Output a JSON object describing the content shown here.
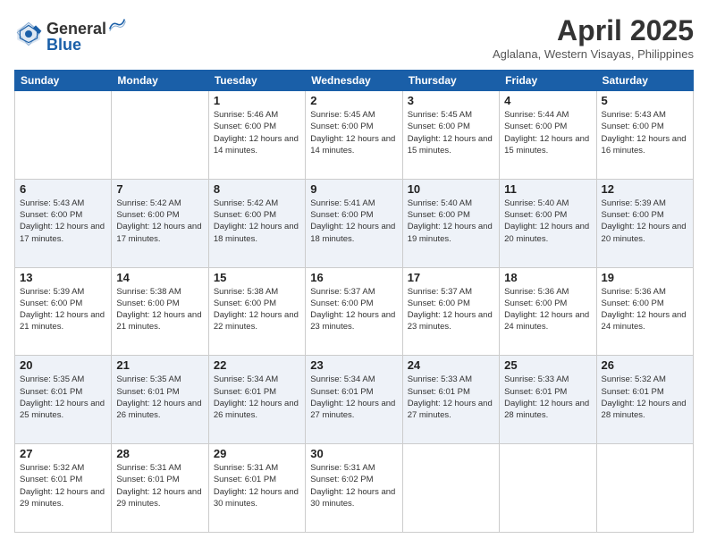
{
  "header": {
    "logo_general": "General",
    "logo_blue": "Blue",
    "month_year": "April 2025",
    "location": "Aglalana, Western Visayas, Philippines"
  },
  "columns": [
    "Sunday",
    "Monday",
    "Tuesday",
    "Wednesday",
    "Thursday",
    "Friday",
    "Saturday"
  ],
  "weeks": [
    [
      {
        "day": "",
        "info": ""
      },
      {
        "day": "",
        "info": ""
      },
      {
        "day": "1",
        "info": "Sunrise: 5:46 AM\nSunset: 6:00 PM\nDaylight: 12 hours\nand 14 minutes."
      },
      {
        "day": "2",
        "info": "Sunrise: 5:45 AM\nSunset: 6:00 PM\nDaylight: 12 hours\nand 14 minutes."
      },
      {
        "day": "3",
        "info": "Sunrise: 5:45 AM\nSunset: 6:00 PM\nDaylight: 12 hours\nand 15 minutes."
      },
      {
        "day": "4",
        "info": "Sunrise: 5:44 AM\nSunset: 6:00 PM\nDaylight: 12 hours\nand 15 minutes."
      },
      {
        "day": "5",
        "info": "Sunrise: 5:43 AM\nSunset: 6:00 PM\nDaylight: 12 hours\nand 16 minutes."
      }
    ],
    [
      {
        "day": "6",
        "info": "Sunrise: 5:43 AM\nSunset: 6:00 PM\nDaylight: 12 hours\nand 17 minutes."
      },
      {
        "day": "7",
        "info": "Sunrise: 5:42 AM\nSunset: 6:00 PM\nDaylight: 12 hours\nand 17 minutes."
      },
      {
        "day": "8",
        "info": "Sunrise: 5:42 AM\nSunset: 6:00 PM\nDaylight: 12 hours\nand 18 minutes."
      },
      {
        "day": "9",
        "info": "Sunrise: 5:41 AM\nSunset: 6:00 PM\nDaylight: 12 hours\nand 18 minutes."
      },
      {
        "day": "10",
        "info": "Sunrise: 5:40 AM\nSunset: 6:00 PM\nDaylight: 12 hours\nand 19 minutes."
      },
      {
        "day": "11",
        "info": "Sunrise: 5:40 AM\nSunset: 6:00 PM\nDaylight: 12 hours\nand 20 minutes."
      },
      {
        "day": "12",
        "info": "Sunrise: 5:39 AM\nSunset: 6:00 PM\nDaylight: 12 hours\nand 20 minutes."
      }
    ],
    [
      {
        "day": "13",
        "info": "Sunrise: 5:39 AM\nSunset: 6:00 PM\nDaylight: 12 hours\nand 21 minutes."
      },
      {
        "day": "14",
        "info": "Sunrise: 5:38 AM\nSunset: 6:00 PM\nDaylight: 12 hours\nand 21 minutes."
      },
      {
        "day": "15",
        "info": "Sunrise: 5:38 AM\nSunset: 6:00 PM\nDaylight: 12 hours\nand 22 minutes."
      },
      {
        "day": "16",
        "info": "Sunrise: 5:37 AM\nSunset: 6:00 PM\nDaylight: 12 hours\nand 23 minutes."
      },
      {
        "day": "17",
        "info": "Sunrise: 5:37 AM\nSunset: 6:00 PM\nDaylight: 12 hours\nand 23 minutes."
      },
      {
        "day": "18",
        "info": "Sunrise: 5:36 AM\nSunset: 6:00 PM\nDaylight: 12 hours\nand 24 minutes."
      },
      {
        "day": "19",
        "info": "Sunrise: 5:36 AM\nSunset: 6:00 PM\nDaylight: 12 hours\nand 24 minutes."
      }
    ],
    [
      {
        "day": "20",
        "info": "Sunrise: 5:35 AM\nSunset: 6:01 PM\nDaylight: 12 hours\nand 25 minutes."
      },
      {
        "day": "21",
        "info": "Sunrise: 5:35 AM\nSunset: 6:01 PM\nDaylight: 12 hours\nand 26 minutes."
      },
      {
        "day": "22",
        "info": "Sunrise: 5:34 AM\nSunset: 6:01 PM\nDaylight: 12 hours\nand 26 minutes."
      },
      {
        "day": "23",
        "info": "Sunrise: 5:34 AM\nSunset: 6:01 PM\nDaylight: 12 hours\nand 27 minutes."
      },
      {
        "day": "24",
        "info": "Sunrise: 5:33 AM\nSunset: 6:01 PM\nDaylight: 12 hours\nand 27 minutes."
      },
      {
        "day": "25",
        "info": "Sunrise: 5:33 AM\nSunset: 6:01 PM\nDaylight: 12 hours\nand 28 minutes."
      },
      {
        "day": "26",
        "info": "Sunrise: 5:32 AM\nSunset: 6:01 PM\nDaylight: 12 hours\nand 28 minutes."
      }
    ],
    [
      {
        "day": "27",
        "info": "Sunrise: 5:32 AM\nSunset: 6:01 PM\nDaylight: 12 hours\nand 29 minutes."
      },
      {
        "day": "28",
        "info": "Sunrise: 5:31 AM\nSunset: 6:01 PM\nDaylight: 12 hours\nand 29 minutes."
      },
      {
        "day": "29",
        "info": "Sunrise: 5:31 AM\nSunset: 6:01 PM\nDaylight: 12 hours\nand 30 minutes."
      },
      {
        "day": "30",
        "info": "Sunrise: 5:31 AM\nSunset: 6:02 PM\nDaylight: 12 hours\nand 30 minutes."
      },
      {
        "day": "",
        "info": ""
      },
      {
        "day": "",
        "info": ""
      },
      {
        "day": "",
        "info": ""
      }
    ]
  ]
}
